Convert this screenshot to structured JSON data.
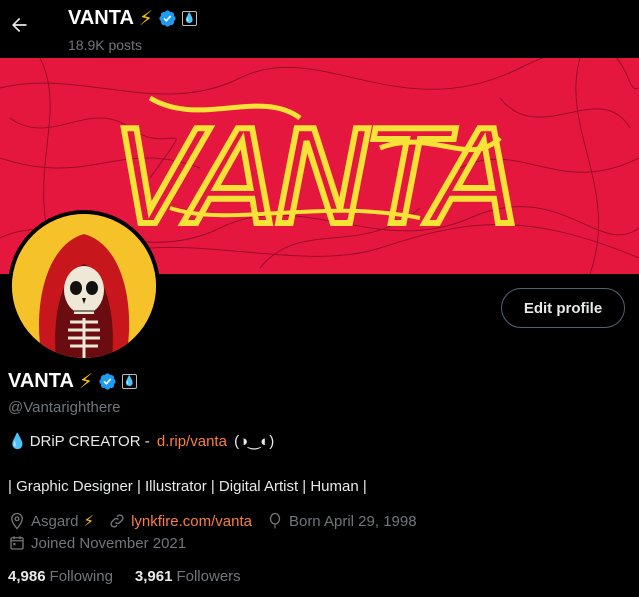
{
  "header": {
    "title": "VANTA",
    "title_emoji": "⚡",
    "posts_count": "18.9K posts"
  },
  "banner": {
    "text": "VANTA",
    "background_color": "#e5173f",
    "text_color": "#f7e337"
  },
  "profile": {
    "name": "VANTA",
    "name_emoji": "⚡",
    "handle": "@Vantarighthere",
    "edit_button_label": "Edit profile",
    "bio_line1": {
      "emoji": "💧",
      "text": "DRiP CREATOR - ",
      "link": "d.rip/vanta",
      "face": " (◑‿◐)"
    },
    "bio_line2": "| Graphic Designer | Illustrator | Digital Artist | Human |",
    "location": "Asgard",
    "location_emoji": "⚡",
    "website": "lynkfire.com/vanta",
    "birthday": "Born April 29, 1998",
    "joined": "Joined November 2021",
    "following_count": "4,986",
    "following_label": "Following",
    "followers_count": "3,961",
    "followers_label": "Followers"
  },
  "icons": {
    "back": "arrow-left-icon",
    "verified": "verified-badge-icon",
    "drop_badge": "drop-badge-icon",
    "location": "location-pin-icon",
    "link": "link-icon",
    "birthday": "balloon-icon",
    "calendar": "calendar-icon"
  },
  "colors": {
    "accent_link": "#f97f3f",
    "verified_blue": "#1d9bf0",
    "muted": "#71767b",
    "background": "#000000"
  }
}
